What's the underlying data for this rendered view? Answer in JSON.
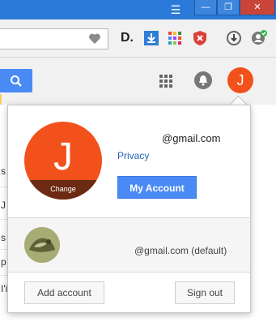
{
  "window": {
    "minimize_label": "—",
    "restore_label": "❐",
    "close_label": "✕",
    "menu_icon": "hamburger-icon"
  },
  "toolbar": {
    "bookmark_icon": "heart-icon",
    "extensions": [
      {
        "name": "d-icon",
        "label": "D."
      },
      {
        "name": "download-icon"
      },
      {
        "name": "colorgrid-icon"
      },
      {
        "name": "shield-x-icon"
      },
      {
        "name": "clock-download-icon"
      },
      {
        "name": "account-check-icon"
      }
    ]
  },
  "gmail_header": {
    "search_icon": "search-icon",
    "apps_icon": "apps-grid-icon",
    "notifications_icon": "bell-icon",
    "avatar_letter": "J",
    "avatar_color": "#f2511b"
  },
  "background_page": {
    "letters": [
      "s",
      "J",
      "s",
      "p",
      "I'i"
    ]
  },
  "account_popup": {
    "avatar_letter": "J",
    "avatar_change_label": "Change",
    "email": "@gmail.com",
    "privacy_label": "Privacy",
    "my_account_label": "My Account",
    "secondary_email": "@gmail.com (default)",
    "add_account_label": "Add account",
    "sign_out_label": "Sign out"
  },
  "colors": {
    "accent": "#4a8af4",
    "avatar": "#f2511b",
    "titlebar": "#2b79d8"
  }
}
